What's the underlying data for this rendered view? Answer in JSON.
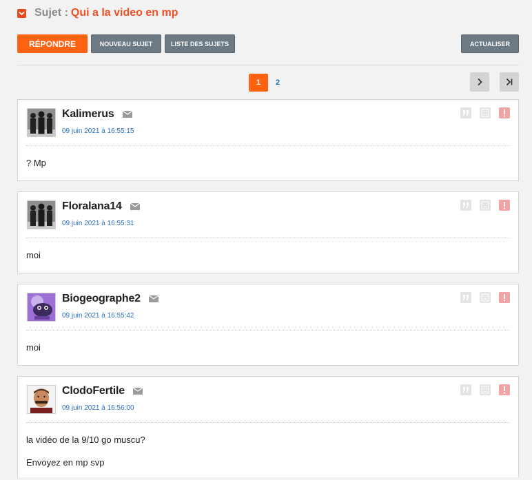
{
  "topic": {
    "prefix": "Sujet :",
    "title": "Qui a la video en mp"
  },
  "toolbar": {
    "reply_label": "RÉPONDRE",
    "new_topic_label": "NOUVEAU SUJET",
    "topic_list_label": "LISTE DES SUJETS",
    "refresh_label": "ACTUALISER"
  },
  "pagination": {
    "current_page": "1",
    "pages": [
      "1",
      "2"
    ],
    "next_icon": "chevron-right-icon",
    "last_icon": "last-page-icon"
  },
  "colors": {
    "accent": "#ff6211",
    "title": "#f04e23",
    "link": "#2a6ebb",
    "grey_button": "#6d7a84"
  },
  "posts": [
    {
      "author": "Kalimerus",
      "date": "09 juin 2021 à 16:55:15",
      "avatar": "default-silhouettes-avatar",
      "content": [
        "? Mp"
      ]
    },
    {
      "author": "Floralana14",
      "date": "09 juin 2021 à 16:55:31",
      "avatar": "default-silhouettes-avatar",
      "content": [
        "moi"
      ]
    },
    {
      "author": "Biogeographe2",
      "date": "09 juin 2021 à 16:55:42",
      "avatar": "purple-creature-avatar",
      "content": [
        "moi"
      ]
    },
    {
      "author": "ClodoFertile",
      "date": "09 juin 2021 à 16:56:00",
      "avatar": "mustache-man-avatar",
      "content": [
        "la vidéo de la 9/10 go muscu?",
        "Envoyez en mp svp"
      ]
    }
  ]
}
